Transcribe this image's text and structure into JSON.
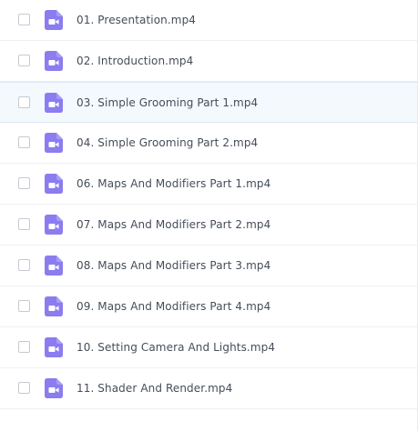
{
  "files": [
    {
      "name": "01. Presentation.mp4",
      "icon": "video-file-icon"
    },
    {
      "name": "02. Introduction.mp4",
      "icon": "video-file-icon"
    },
    {
      "name": "03. Simple Grooming Part 1.mp4",
      "icon": "video-file-icon",
      "highlighted": true
    },
    {
      "name": "04. Simple Grooming Part 2.mp4",
      "icon": "video-file-icon"
    },
    {
      "name": "06. Maps And Modifiers Part 1.mp4",
      "icon": "video-file-icon"
    },
    {
      "name": "07. Maps And Modifiers Part 2.mp4",
      "icon": "video-file-icon"
    },
    {
      "name": "08. Maps And Modifiers Part 3.mp4",
      "icon": "video-file-icon"
    },
    {
      "name": "09. Maps And Modifiers Part 4.mp4",
      "icon": "video-file-icon"
    },
    {
      "name": "10. Setting Camera And Lights.mp4",
      "icon": "video-file-icon"
    },
    {
      "name": "11. Shader And Render.mp4",
      "icon": "video-file-icon"
    }
  ],
  "colors": {
    "icon_bg": "#8b7cf0",
    "icon_fg": "#ffffff",
    "highlight_bg": "#f4f9fe",
    "text": "#454d5a"
  }
}
